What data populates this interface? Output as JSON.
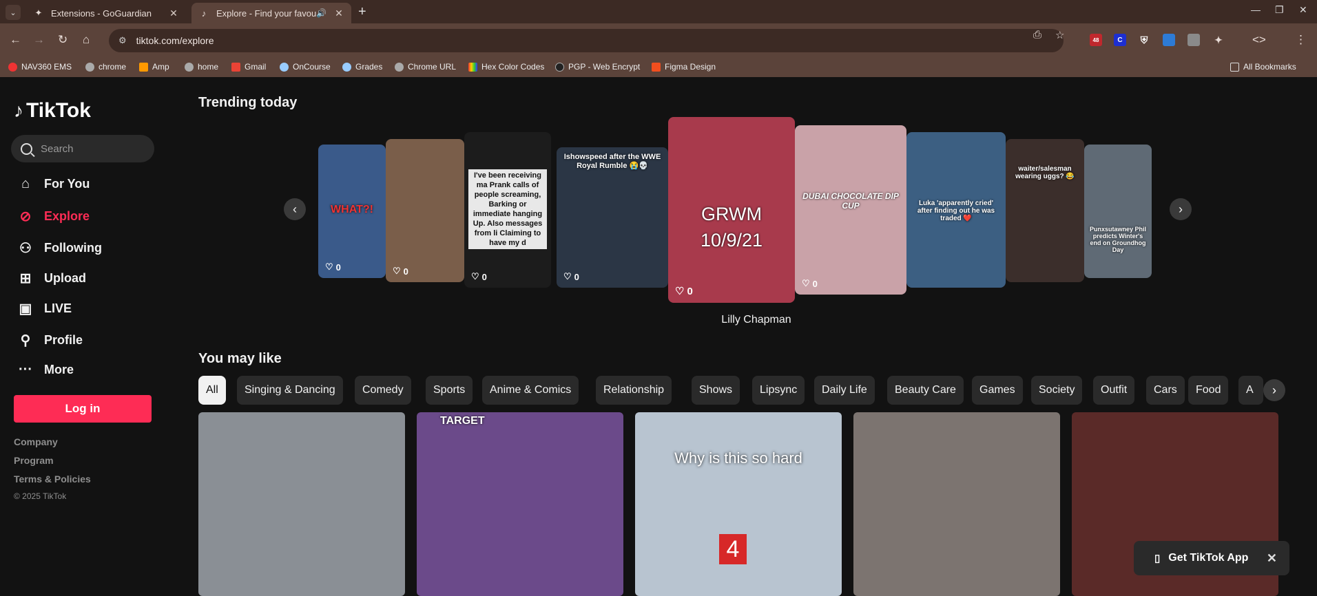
{
  "browser": {
    "tabs": [
      {
        "title": "Extensions - GoGuardian",
        "active": false
      },
      {
        "title": "Explore - Find your favourite",
        "active": true
      }
    ],
    "url": "tiktok.com/explore",
    "bookmarks": [
      "NAV360 EMS",
      "chrome",
      "Amp",
      "home",
      "Gmail",
      "OnCourse",
      "Grades",
      "Chrome URL",
      "Hex Color Codes",
      "PGP - Web Encrypt",
      "Figma Design"
    ],
    "all_bookmarks": "All Bookmarks",
    "ext_badge": "48"
  },
  "sidebar": {
    "logo": "TikTok",
    "search_placeholder": "Search",
    "nav": [
      {
        "label": "For You",
        "icon": "home-icon"
      },
      {
        "label": "Explore",
        "icon": "compass-icon"
      },
      {
        "label": "Following",
        "icon": "user-follow-icon"
      },
      {
        "label": "Upload",
        "icon": "plus-square-icon"
      },
      {
        "label": "LIVE",
        "icon": "live-camera-icon"
      },
      {
        "label": "Profile",
        "icon": "user-icon"
      },
      {
        "label": "More",
        "icon": "more-dots-icon"
      }
    ],
    "login": "Log in",
    "footer": [
      "Company",
      "Program",
      "Terms & Policies"
    ],
    "copyright": "© 2025 TikTok"
  },
  "trending": {
    "title": "Trending today",
    "featured_name": "Lilly Chapman",
    "cards": [
      {
        "likes": "0",
        "overlay": "WHAT?!",
        "color": "#3a5a8a"
      },
      {
        "likes": "0",
        "overlay": "",
        "color": "#7a5e4a"
      },
      {
        "likes": "0",
        "overlay": "I've been receiving ma Prank calls of people screaming, Barking or immediate hanging Up. Also messages from li Claiming to have my d",
        "color": "#1c1c1c"
      },
      {
        "likes": "0",
        "overlay": "Ishowspeed after the WWE Royal Rumble 😭💀",
        "color": "#2b3645"
      },
      {
        "likes": "0",
        "overlay": "GRWM 10/9/21",
        "color": "#a83a4c"
      },
      {
        "likes": "0",
        "overlay": "DUBAI CHOCOLATE DIP CUP",
        "color": "#c9a2a8"
      },
      {
        "likes": "",
        "overlay": "Luka 'apparently cried' after finding out he was traded ❤️",
        "color": "#3c5f82"
      },
      {
        "likes": "",
        "overlay": "waiter/salesman wearing uggs? 😂",
        "color": "#3b2e2b"
      },
      {
        "likes": "",
        "overlay": "Punxsutawney Phil predicts Winter's end on Groundhog Day",
        "color": "#5f6a75"
      }
    ]
  },
  "you_may_like": {
    "title": "You may like",
    "chips": [
      "All",
      "Singing & Dancing",
      "Comedy",
      "Sports",
      "Anime & Comics",
      "Relationship",
      "Shows",
      "Lipsync",
      "Daily Life",
      "Beauty Care",
      "Games",
      "Society",
      "Outfit",
      "Cars",
      "Food",
      "A"
    ],
    "videos": [
      {
        "overlay": "",
        "color": "#8a8f95"
      },
      {
        "overlay": "TARGET",
        "color": "#6b4a8a"
      },
      {
        "overlay": "Why is this so hard",
        "color": "#b8c4d0"
      },
      {
        "overlay": "",
        "color": "#7c7470"
      },
      {
        "overlay": "",
        "color": "#5a2a28"
      }
    ],
    "game_number": "4"
  },
  "promo": {
    "label": "Get TikTok App"
  }
}
